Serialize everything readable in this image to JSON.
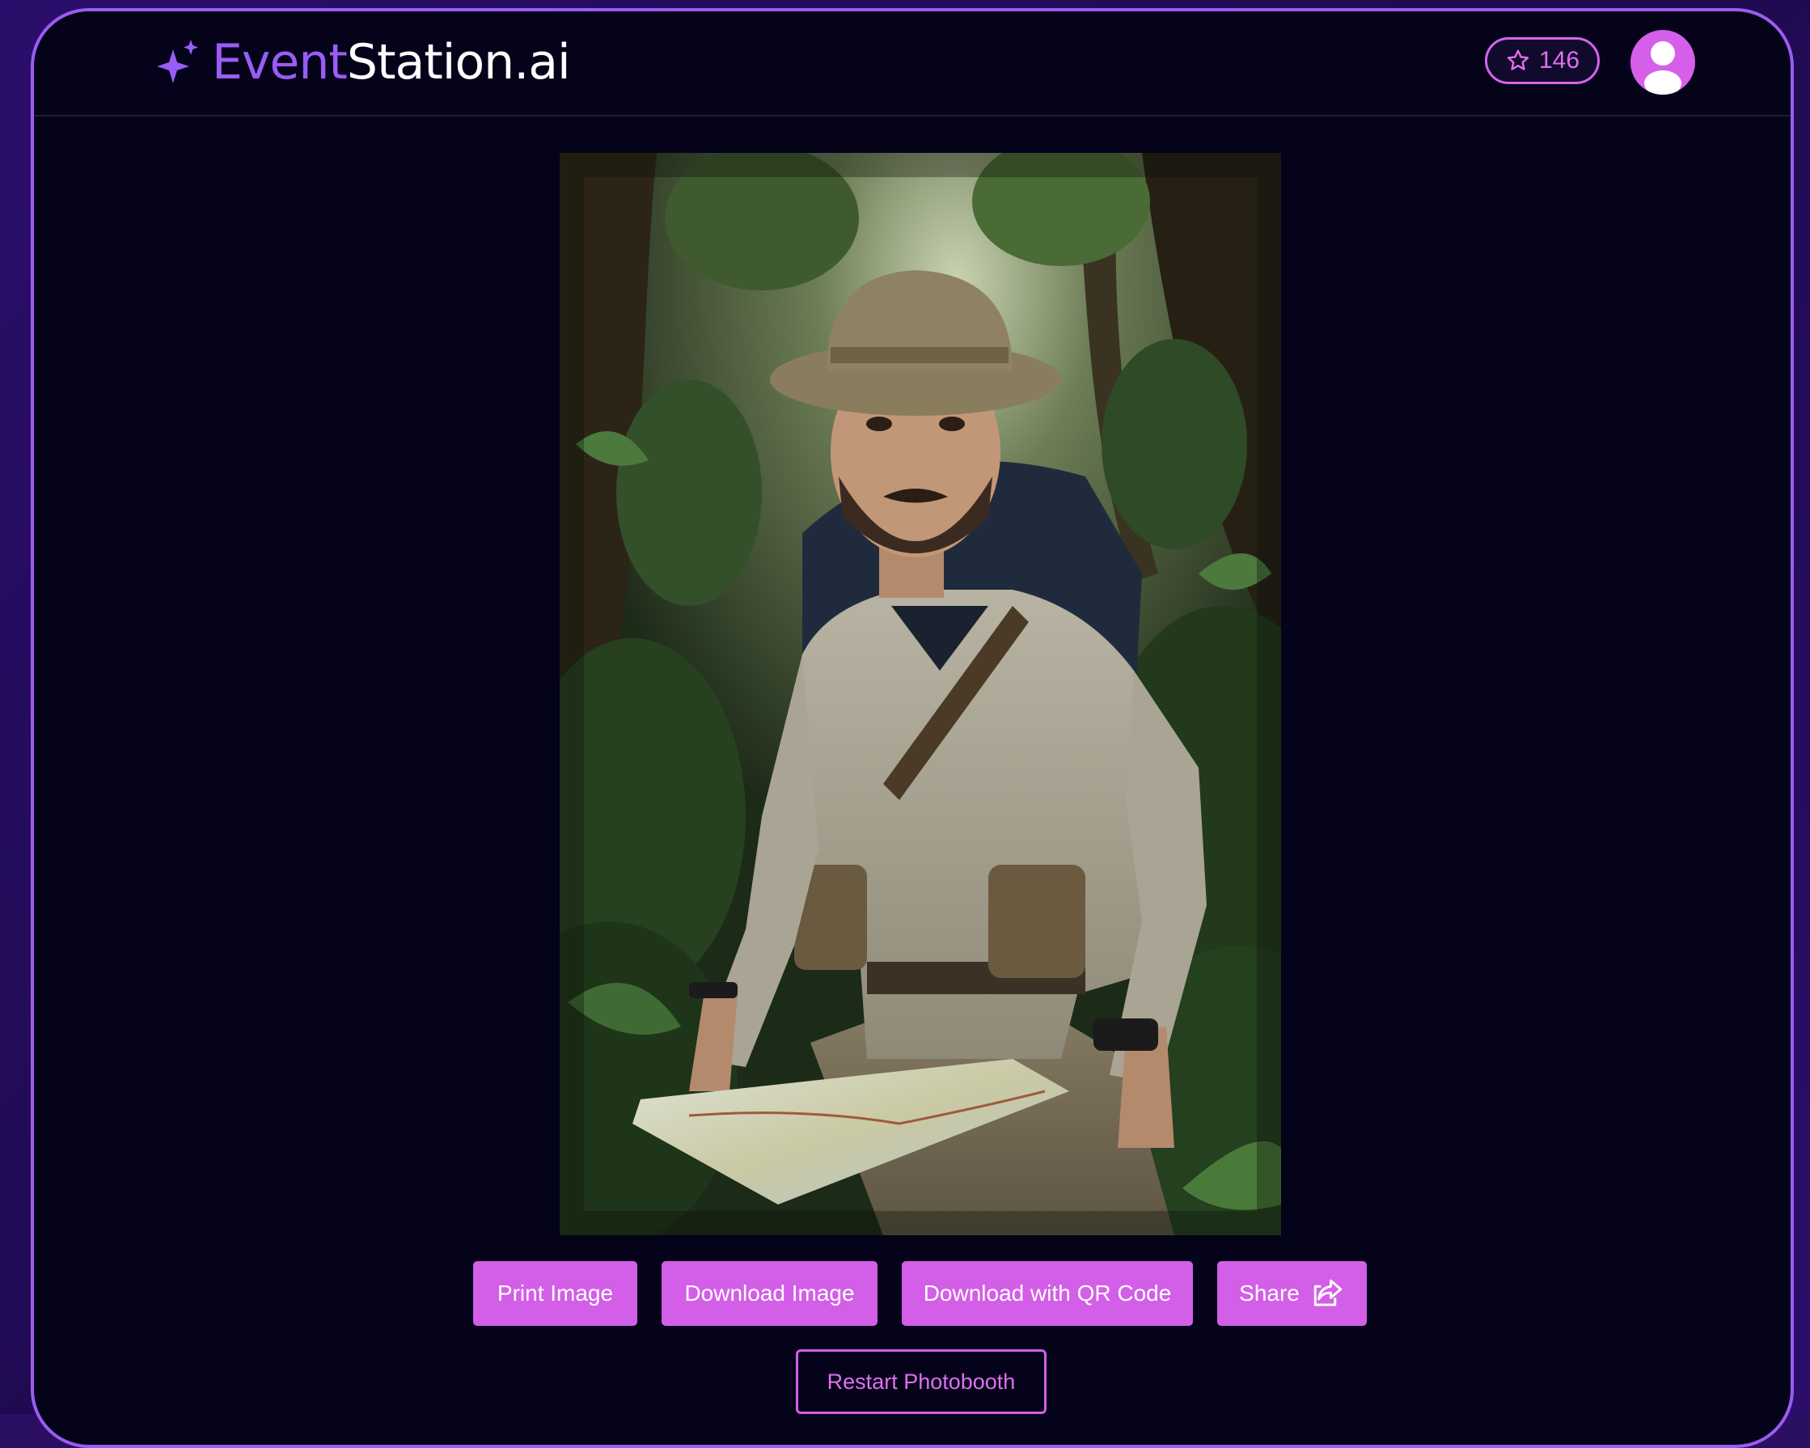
{
  "brand": {
    "name_part1": "Event",
    "name_part2": "Station.ai",
    "icon": "sparkle-icon",
    "accent": "#9a5cf5"
  },
  "header": {
    "credits_count": "146",
    "credits_icon": "star-icon",
    "avatar_icon": "user-icon"
  },
  "photo": {
    "description_icon": "generated-portrait-image"
  },
  "actions": {
    "print": "Print Image",
    "download": "Download Image",
    "download_qr": "Download with QR Code",
    "share": "Share",
    "share_icon": "share-icon",
    "restart": "Restart Photobooth"
  },
  "colors": {
    "button_bg": "#d35ee8",
    "page_bg": "#04031a",
    "frame_border": "#9c5cf0"
  }
}
